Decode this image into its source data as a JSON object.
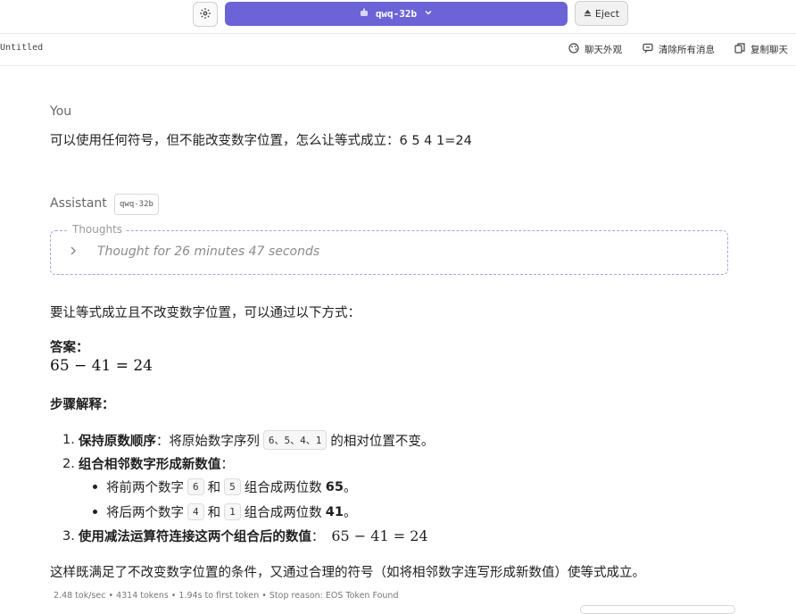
{
  "topbar": {
    "model_name": "qwq-32b",
    "eject_label": "Eject"
  },
  "subbar": {
    "chat_title": "Untitled",
    "actions": [
      "聊天外观",
      "清除所有消息",
      "复制聊天"
    ]
  },
  "conversation": {
    "user_role": "You",
    "user_message": "可以使用任何符号，但不能改变数字位置，怎么让等式成立：6 5 4 1=24",
    "assistant_role": "Assistant",
    "assistant_model_tag": "qwq-32b",
    "thoughts_label": "Thoughts",
    "thoughts_summary": "Thought for 26 minutes 47 seconds",
    "intro": "要让等式成立且不改变数字位置，可以通过以下方式：",
    "answer_heading": "答案：",
    "answer_math": "65 − 41 = 24",
    "steps_heading": "步骤解释：",
    "step1_num": "1.",
    "step1_bold": "保持原数顺序",
    "step1_pre": "：将原始数字序列",
    "step1_code": "6、5、4、1",
    "step1_post": "的相对位置不变。",
    "step2_num": "2.",
    "step2_bold": "组合相邻数字形成新数值",
    "step2_colon": "：",
    "sub1_pre": "将前两个数字",
    "sub1_code_a": "6",
    "sub_and": "和",
    "sub1_code_b": "5",
    "sub1_post": "组合成两位数",
    "sub1_result": "65",
    "sub1_end": "。",
    "sub2_pre": "将后两个数字",
    "sub2_code_a": "4",
    "sub2_code_b": "1",
    "sub2_post": "组合成两位数",
    "sub2_result": "41",
    "sub2_end": "。",
    "step3_num": "3.",
    "step3_bold": "使用减法运算符连接这两个组合后的数值",
    "step3_colon": "：",
    "step3_math": "65 − 41 = 24",
    "conclusion": "这样既满足了不改变数字位置的条件，又通过合理的符号（如将相邻数字连写形成新数值）使等式成立。",
    "stats": "2.48 tok/sec • 4314 tokens • 1.94s to first token • Stop reason: EOS Token Found"
  },
  "colors": {
    "accent": "#6b63d6",
    "thoughts_border": "#a9a2e0"
  }
}
